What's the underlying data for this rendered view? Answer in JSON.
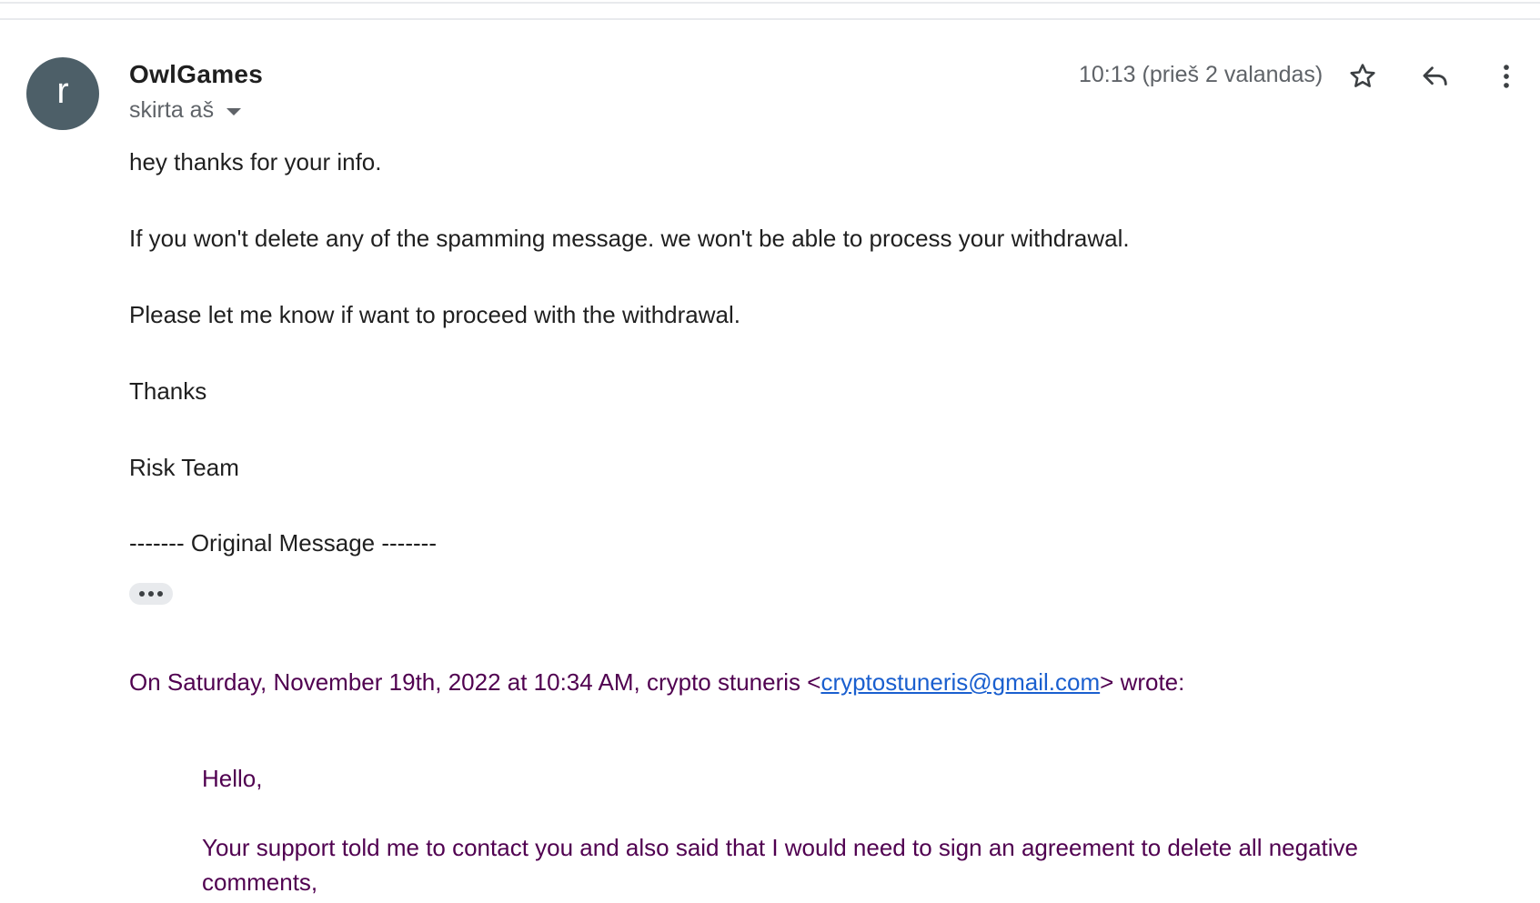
{
  "sender": {
    "avatar_letter": "r",
    "name": "OwlGames",
    "recipient_label": "skirta aš",
    "timestamp": "10:13 (prieš 2 valandas)"
  },
  "actions": {
    "star_icon": "star-outline-icon",
    "reply_icon": "reply-icon",
    "more_icon": "more-vertical-icon"
  },
  "message": {
    "line1": "hey thanks for your info.",
    "line2": "If you won't delete any of the spamming message. we won't be able to process your withdrawal.",
    "line3": "Please let me know if want to proceed with the withdrawal.",
    "line4": "Thanks",
    "line5": "Risk Team",
    "original_separator": "------- Original Message -------"
  },
  "quoted": {
    "header_prefix": "On Saturday, November 19th, 2022 at 10:34 AM, crypto stuneris <",
    "email": "cryptostuneris@gmail.com",
    "header_suffix": "> wrote:",
    "greeting": "Hello,",
    "paragraph": "Your support told me to contact you and also said that I would need to sign an agreement to delete all negative comments,"
  },
  "colors": {
    "avatar_bg": "#4d5f68",
    "quoted_text": "#500050",
    "link": "#1a5fcf"
  }
}
